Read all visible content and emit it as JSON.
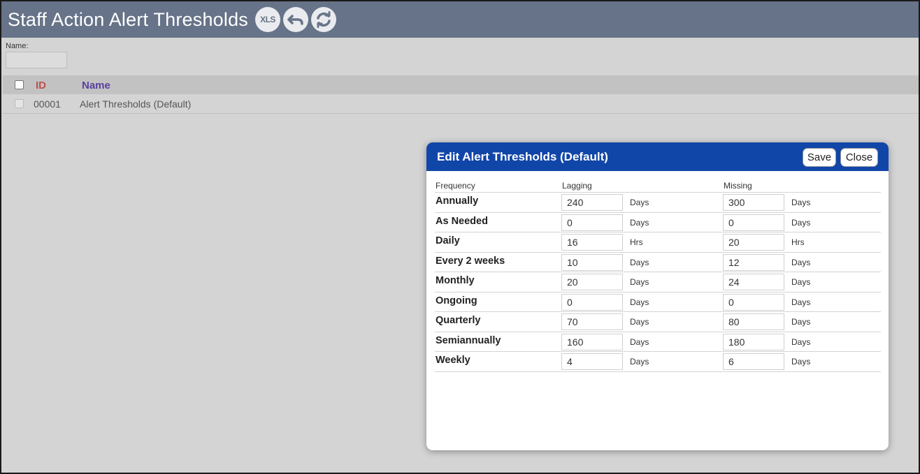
{
  "header": {
    "title": "Staff Action Alert Thresholds",
    "xls_label": "XLS"
  },
  "filter": {
    "name_label": "Name:",
    "name_value": ""
  },
  "grid": {
    "col_id": "ID",
    "col_name": "Name",
    "rows": [
      {
        "id": "00001",
        "name": "Alert Thresholds (Default)"
      }
    ]
  },
  "dialog": {
    "title": "Edit Alert Thresholds (Default)",
    "save_label": "Save",
    "close_label": "Close",
    "col_frequency": "Frequency",
    "col_lagging": "Lagging",
    "col_missing": "Missing",
    "rows": [
      {
        "frequency": "Annually",
        "lagging": "240",
        "lagging_unit": "Days",
        "missing": "300",
        "missing_unit": "Days"
      },
      {
        "frequency": "As Needed",
        "lagging": "0",
        "lagging_unit": "Days",
        "missing": "0",
        "missing_unit": "Days"
      },
      {
        "frequency": "Daily",
        "lagging": "16",
        "lagging_unit": "Hrs",
        "missing": "20",
        "missing_unit": "Hrs"
      },
      {
        "frequency": "Every 2 weeks",
        "lagging": "10",
        "lagging_unit": "Days",
        "missing": "12",
        "missing_unit": "Days"
      },
      {
        "frequency": "Monthly",
        "lagging": "20",
        "lagging_unit": "Days",
        "missing": "24",
        "missing_unit": "Days"
      },
      {
        "frequency": "Ongoing",
        "lagging": "0",
        "lagging_unit": "Days",
        "missing": "0",
        "missing_unit": "Days"
      },
      {
        "frequency": "Quarterly",
        "lagging": "70",
        "lagging_unit": "Days",
        "missing": "80",
        "missing_unit": "Days"
      },
      {
        "frequency": "Semiannually",
        "lagging": "160",
        "lagging_unit": "Days",
        "missing": "180",
        "missing_unit": "Days"
      },
      {
        "frequency": "Weekly",
        "lagging": "4",
        "lagging_unit": "Days",
        "missing": "6",
        "missing_unit": "Days"
      }
    ]
  },
  "colors": {
    "header_bg": "#667388",
    "dialog_header_bg": "#1146a9",
    "id_header": "#c0504d",
    "name_header": "#5a3f9e"
  }
}
